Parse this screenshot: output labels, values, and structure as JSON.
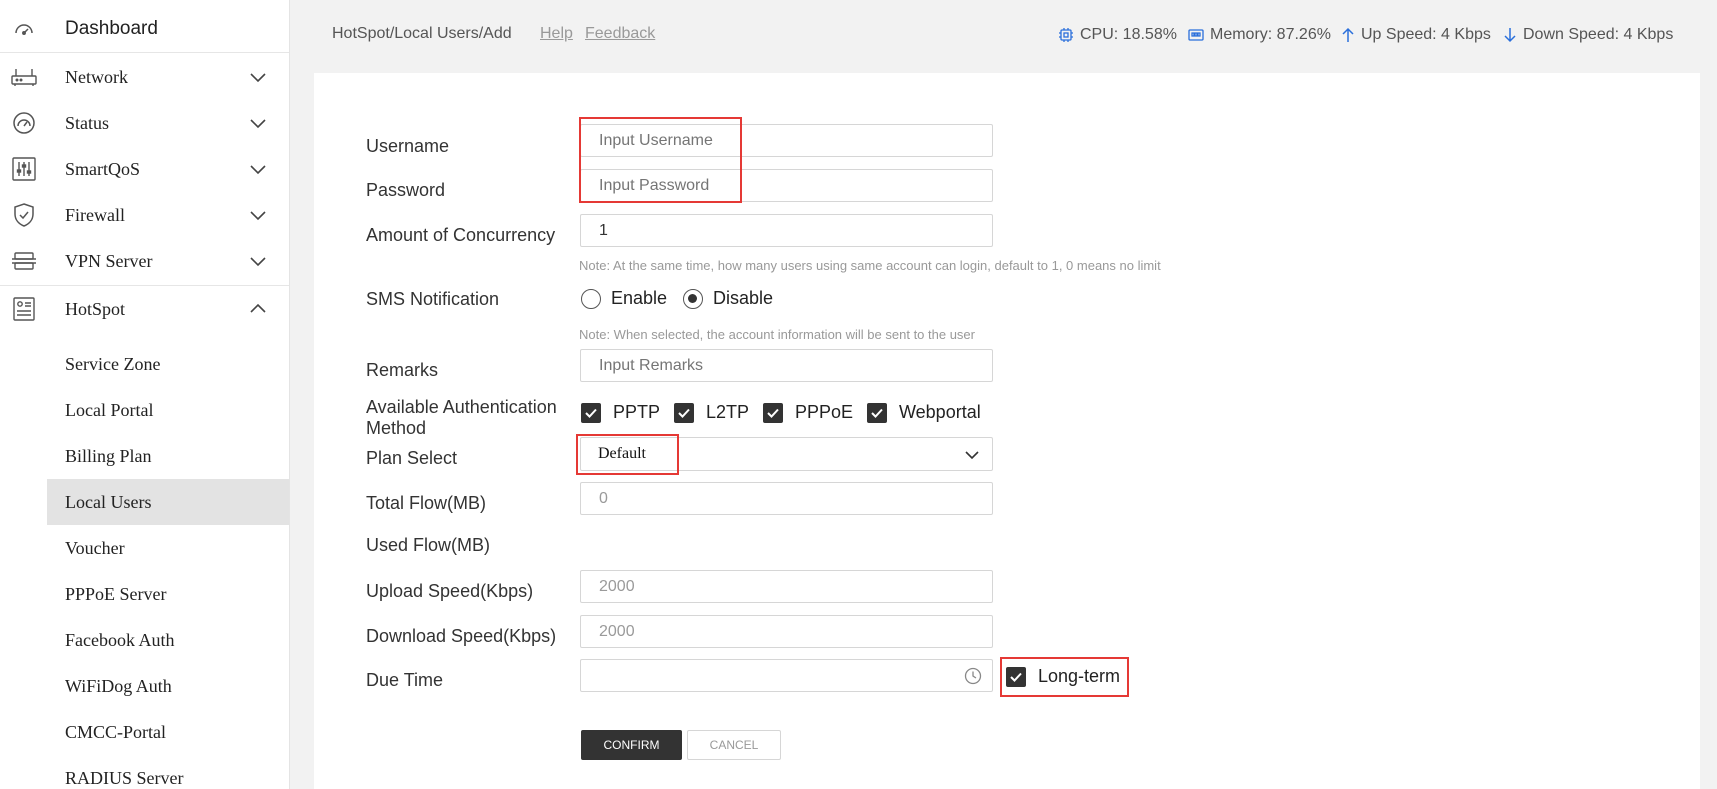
{
  "sidebar": {
    "items": [
      {
        "label": "Dashboard",
        "icon": "dashboard-icon"
      },
      {
        "label": "Network",
        "icon": "router-icon"
      },
      {
        "label": "Status",
        "icon": "gauge-icon"
      },
      {
        "label": "SmartQoS",
        "icon": "sliders-icon"
      },
      {
        "label": "Firewall",
        "icon": "shield-icon"
      },
      {
        "label": "VPN Server",
        "icon": "server-icon"
      },
      {
        "label": "HotSpot",
        "icon": "hotspot-icon"
      }
    ],
    "hotspot_sub": [
      {
        "label": "Service Zone"
      },
      {
        "label": "Local Portal"
      },
      {
        "label": "Billing Plan"
      },
      {
        "label": "Local Users"
      },
      {
        "label": "Voucher"
      },
      {
        "label": "PPPoE Server"
      },
      {
        "label": "Facebook Auth"
      },
      {
        "label": "WiFiDog Auth"
      },
      {
        "label": "CMCC-Portal"
      },
      {
        "label": "RADIUS Server"
      }
    ]
  },
  "header": {
    "breadcrumb": "HotSpot/Local Users/Add",
    "help": "Help",
    "feedback": "Feedback",
    "cpu": "CPU: 18.58%",
    "memory": "Memory: 87.26%",
    "up_speed": "Up Speed: 4 Kbps",
    "down_speed": "Down Speed: 4 Kbps"
  },
  "form": {
    "username_label": "Username",
    "username_placeholder": "Input Username",
    "password_label": "Password",
    "password_placeholder": "Input Password",
    "concurrency_label": "Amount of Concurrency",
    "concurrency_value": "1",
    "concurrency_note": "Note: At the same time, how many users using same account can login, default to 1, 0 means no limit",
    "sms_label": "SMS Notification",
    "sms_enable": "Enable",
    "sms_disable": "Disable",
    "sms_selected": "Disable",
    "sms_note": "Note: When selected, the account information will be sent to the user",
    "remarks_label": "Remarks",
    "remarks_placeholder": "Input Remarks",
    "auth_label_line1": "Available Authentication",
    "auth_label_line2": "Method",
    "auth_pptp": "PPTP",
    "auth_l2tp": "L2TP",
    "auth_pppoe": "PPPoE",
    "auth_webportal": "Webportal",
    "plan_label": "Plan Select",
    "plan_value": "Default",
    "total_flow_label": "Total Flow(MB)",
    "total_flow_value": "0",
    "used_flow_label": "Used Flow(MB)",
    "upload_label": "Upload Speed(Kbps)",
    "upload_value": "2000",
    "download_label": "Download Speed(Kbps)",
    "download_value": "2000",
    "due_label": "Due Time",
    "long_term_label": "Long-term",
    "confirm": "CONFIRM",
    "cancel": "CANCEL"
  },
  "colors": {
    "highlight": "#e53935",
    "dark_button": "#333333",
    "active_item": "#e3e3e3"
  }
}
